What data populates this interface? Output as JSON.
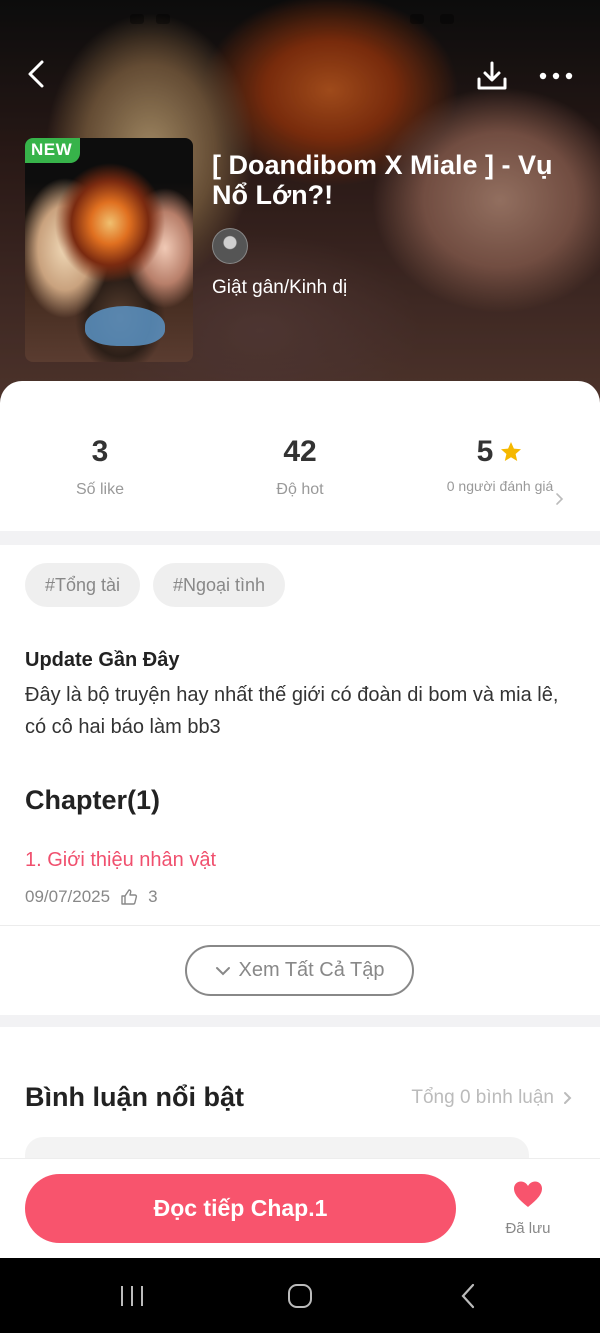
{
  "header": {
    "badge": "NEW",
    "title": "[ Doandibom X Miale ] - Vụ Nổ Lớn?!",
    "genre": "Giật gân/Kinh dị",
    "back_icon": "chevron-left-icon",
    "download_icon": "download-icon",
    "more_icon": "more-horizontal-icon"
  },
  "stats": {
    "likes": {
      "value": "3",
      "label": "Số like"
    },
    "hot": {
      "value": "42",
      "label": "Độ hot"
    },
    "rating": {
      "value": "5",
      "label": "0 người đánh giá",
      "star_color": "#f5b800"
    }
  },
  "tags": [
    "#Tổng tài",
    "#Ngoại tình"
  ],
  "update": {
    "title": "Update Gần Đây",
    "text": "Đây là bộ truyện hay nhất thế giới có đoàn di bom và mia lê, có cô hai báo làm bb3"
  },
  "chapters": {
    "heading": "Chapter(1)",
    "items": [
      {
        "title": "1. Giới thiệu nhân vật",
        "date": "09/07/2025",
        "likes": "3"
      }
    ],
    "view_all": "Xem Tất Cả Tập"
  },
  "comments": {
    "title": "Bình luận nổi bật",
    "total": "Tổng 0 bình luận"
  },
  "actions": {
    "read_button": "Đọc tiếp Chap.1",
    "save_label": "Đã lưu",
    "accent": "#f8546d"
  }
}
